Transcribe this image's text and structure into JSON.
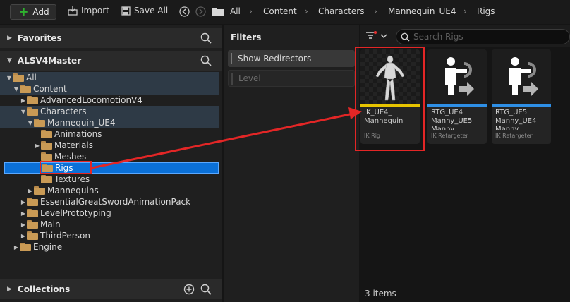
{
  "toolbar": {
    "add_label": "Add",
    "import_label": "Import",
    "save_all_label": "Save All"
  },
  "breadcrumb": [
    "All",
    "Content",
    "Characters",
    "Mannequin_UE4",
    "Rigs"
  ],
  "favorites": {
    "label": "Favorites"
  },
  "project": {
    "label": "ALSV4Master"
  },
  "tree": [
    "All",
    "Content",
    "AdvancedLocomotionV4",
    "Characters",
    "Mannequin_UE4",
    "Animations",
    "Materials",
    "Meshes",
    "Rigs",
    "Textures",
    "Mannequins",
    "EssentialGreatSwordAnimationPack",
    "LevelPrototyping",
    "Main",
    "ThirdPerson",
    "Engine"
  ],
  "collections": {
    "label": "Collections"
  },
  "filters": {
    "title": "Filters",
    "items": [
      "Show Redirectors",
      "Level"
    ]
  },
  "search": {
    "placeholder": "Search Rigs"
  },
  "assets": [
    {
      "name": "IK_UE4_ Mannequin",
      "kind": "IK Rig",
      "stripe": "#e6c300"
    },
    {
      "name": "RTG_UE4 Manny_UE5 Manny",
      "kind": "IK Retargeter",
      "stripe": "#2e8fe6"
    },
    {
      "name": "RTG_UE5 Manny_UE4 Manny",
      "kind": "IK Retargeter",
      "stripe": "#2e8fe6"
    }
  ],
  "status": {
    "items_count": "3 items"
  },
  "colors": {
    "accent": "#0a70d8",
    "annotation": "#e32626"
  }
}
